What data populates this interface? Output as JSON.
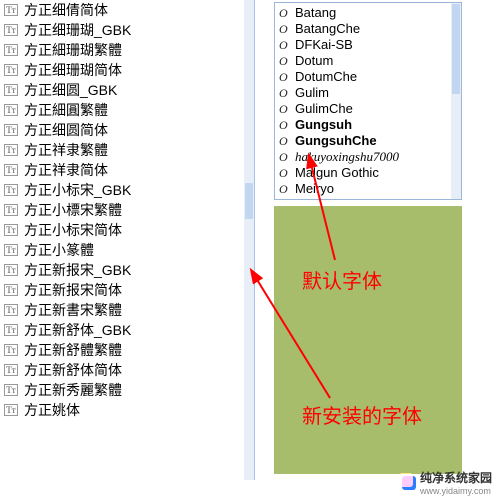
{
  "leftFonts": [
    "方正细倩简体",
    "方正细珊瑚_GBK",
    "方正細珊瑚繁體",
    "方正细珊瑚简体",
    "方正细圆_GBK",
    "方正細圓繁體",
    "方正细圆简体",
    "方正祥隶繁體",
    "方正祥隶简体",
    "方正小标宋_GBK",
    "方正小標宋繁體",
    "方正小标宋简体",
    "方正小篆體",
    "方正新报宋_GBK",
    "方正新报宋简体",
    "方正新書宋繁體",
    "方正新舒体_GBK",
    "方正新舒體繁體",
    "方正新舒体简体",
    "方正新秀麗繁體",
    "方正姚体"
  ],
  "rightFonts": [
    "Batang",
    "BatangChe",
    "DFKai-SB",
    "Dotum",
    "DotumChe",
    "Gulim",
    "GulimChe",
    "Gungsuh",
    "GungsuhChe",
    "hakuyoxingshu7000",
    "Malgun Gothic",
    "Meiryo"
  ],
  "labels": {
    "default": "默认字体",
    "new": "新安装的字体"
  },
  "watermark": {
    "brand": "纯净系统家园",
    "url": "www.yidaimy.com"
  },
  "icons": {
    "tt": "Tᴛ",
    "o": "O"
  }
}
